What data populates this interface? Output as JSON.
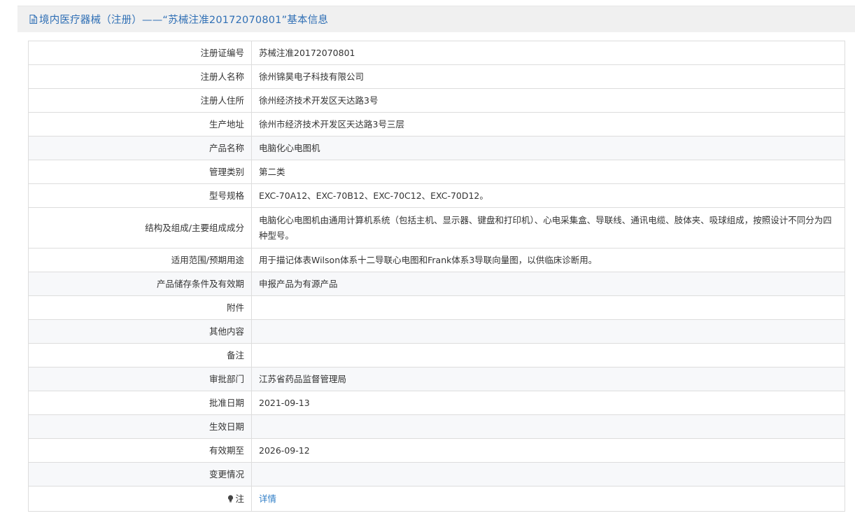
{
  "header": {
    "icon": "document-icon",
    "title": "境内医疗器械（注册）——“苏械注准20172070801”基本信息"
  },
  "rows": [
    {
      "label": "注册证编号",
      "value": "苏械注准20172070801"
    },
    {
      "label": "注册人名称",
      "value": "徐州锦昊电子科技有限公司"
    },
    {
      "label": "注册人住所",
      "value": "徐州经济技术开发区天达路3号"
    },
    {
      "label": "生产地址",
      "value": "徐州市经济技术开发区天达路3号三层"
    },
    {
      "label": "产品名称",
      "value": "电脑化心电图机"
    },
    {
      "label": "管理类别",
      "value": "第二类"
    },
    {
      "label": "型号规格",
      "value": "EXC-70A12、EXC-70B12、EXC-70C12、EXC-70D12。"
    },
    {
      "label": "结构及组成/主要组成成分",
      "value": "电脑化心电图机由通用计算机系统（包括主机、显示器、键盘和打印机）、心电采集盒、导联线、通讯电缆、肢体夹、吸球组成，按照设计不同分为四种型号。"
    },
    {
      "label": "适用范围/预期用途",
      "value": "用于描记体表Wilson体系十二导联心电图和Frank体系3导联向量图，以供临床诊断用。"
    },
    {
      "label": "产品储存条件及有效期",
      "value": "申报产品为有源产品"
    },
    {
      "label": "附件",
      "value": ""
    },
    {
      "label": "其他内容",
      "value": ""
    },
    {
      "label": "备注",
      "value": ""
    },
    {
      "label": "审批部门",
      "value": "江苏省药品监督管理局"
    },
    {
      "label": "批准日期",
      "value": "2021-09-13"
    },
    {
      "label": "生效日期",
      "value": ""
    },
    {
      "label": "有效期至",
      "value": "2026-09-12"
    },
    {
      "label": "变更情况",
      "value": ""
    }
  ],
  "note_row": {
    "icon": "lightbulb-icon",
    "label": "注",
    "link_text": "详情"
  },
  "colors": {
    "header_text": "#2f6fb5",
    "link": "#2f7ec7",
    "border": "#dddddd",
    "alt_row": "#f7f8fa"
  }
}
